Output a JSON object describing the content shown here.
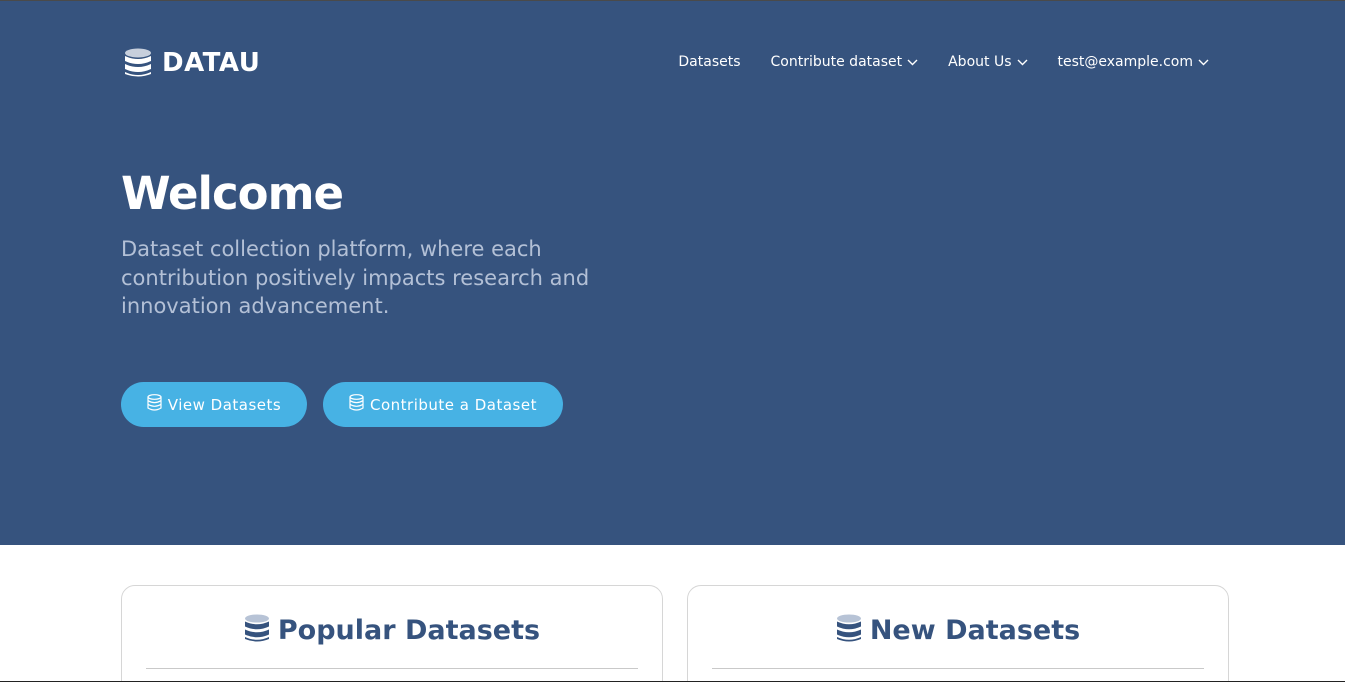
{
  "brand": {
    "name": "DATAU",
    "icon": "database-icon"
  },
  "nav": {
    "items": [
      {
        "label": "Datasets",
        "dropdown": false
      },
      {
        "label": "Contribute dataset",
        "dropdown": true
      },
      {
        "label": "About Us",
        "dropdown": true
      },
      {
        "label": "test@example.com",
        "dropdown": true
      }
    ]
  },
  "hero": {
    "title": "Welcome",
    "tagline": "Dataset collection platform, where each contribution positively impacts research and innovation advancement.",
    "buttons": {
      "view": "View Datasets",
      "contribute": "Contribute a Dataset"
    }
  },
  "sections": {
    "popular": {
      "title": "Popular Datasets",
      "icon": "database-icon"
    },
    "new": {
      "title": "New Datasets",
      "icon": "database-icon"
    }
  },
  "colors": {
    "hero_bg": "#36537e",
    "button_bg": "#47b2e4",
    "tagline": "#b3c0d6",
    "heading": "#36537e"
  }
}
